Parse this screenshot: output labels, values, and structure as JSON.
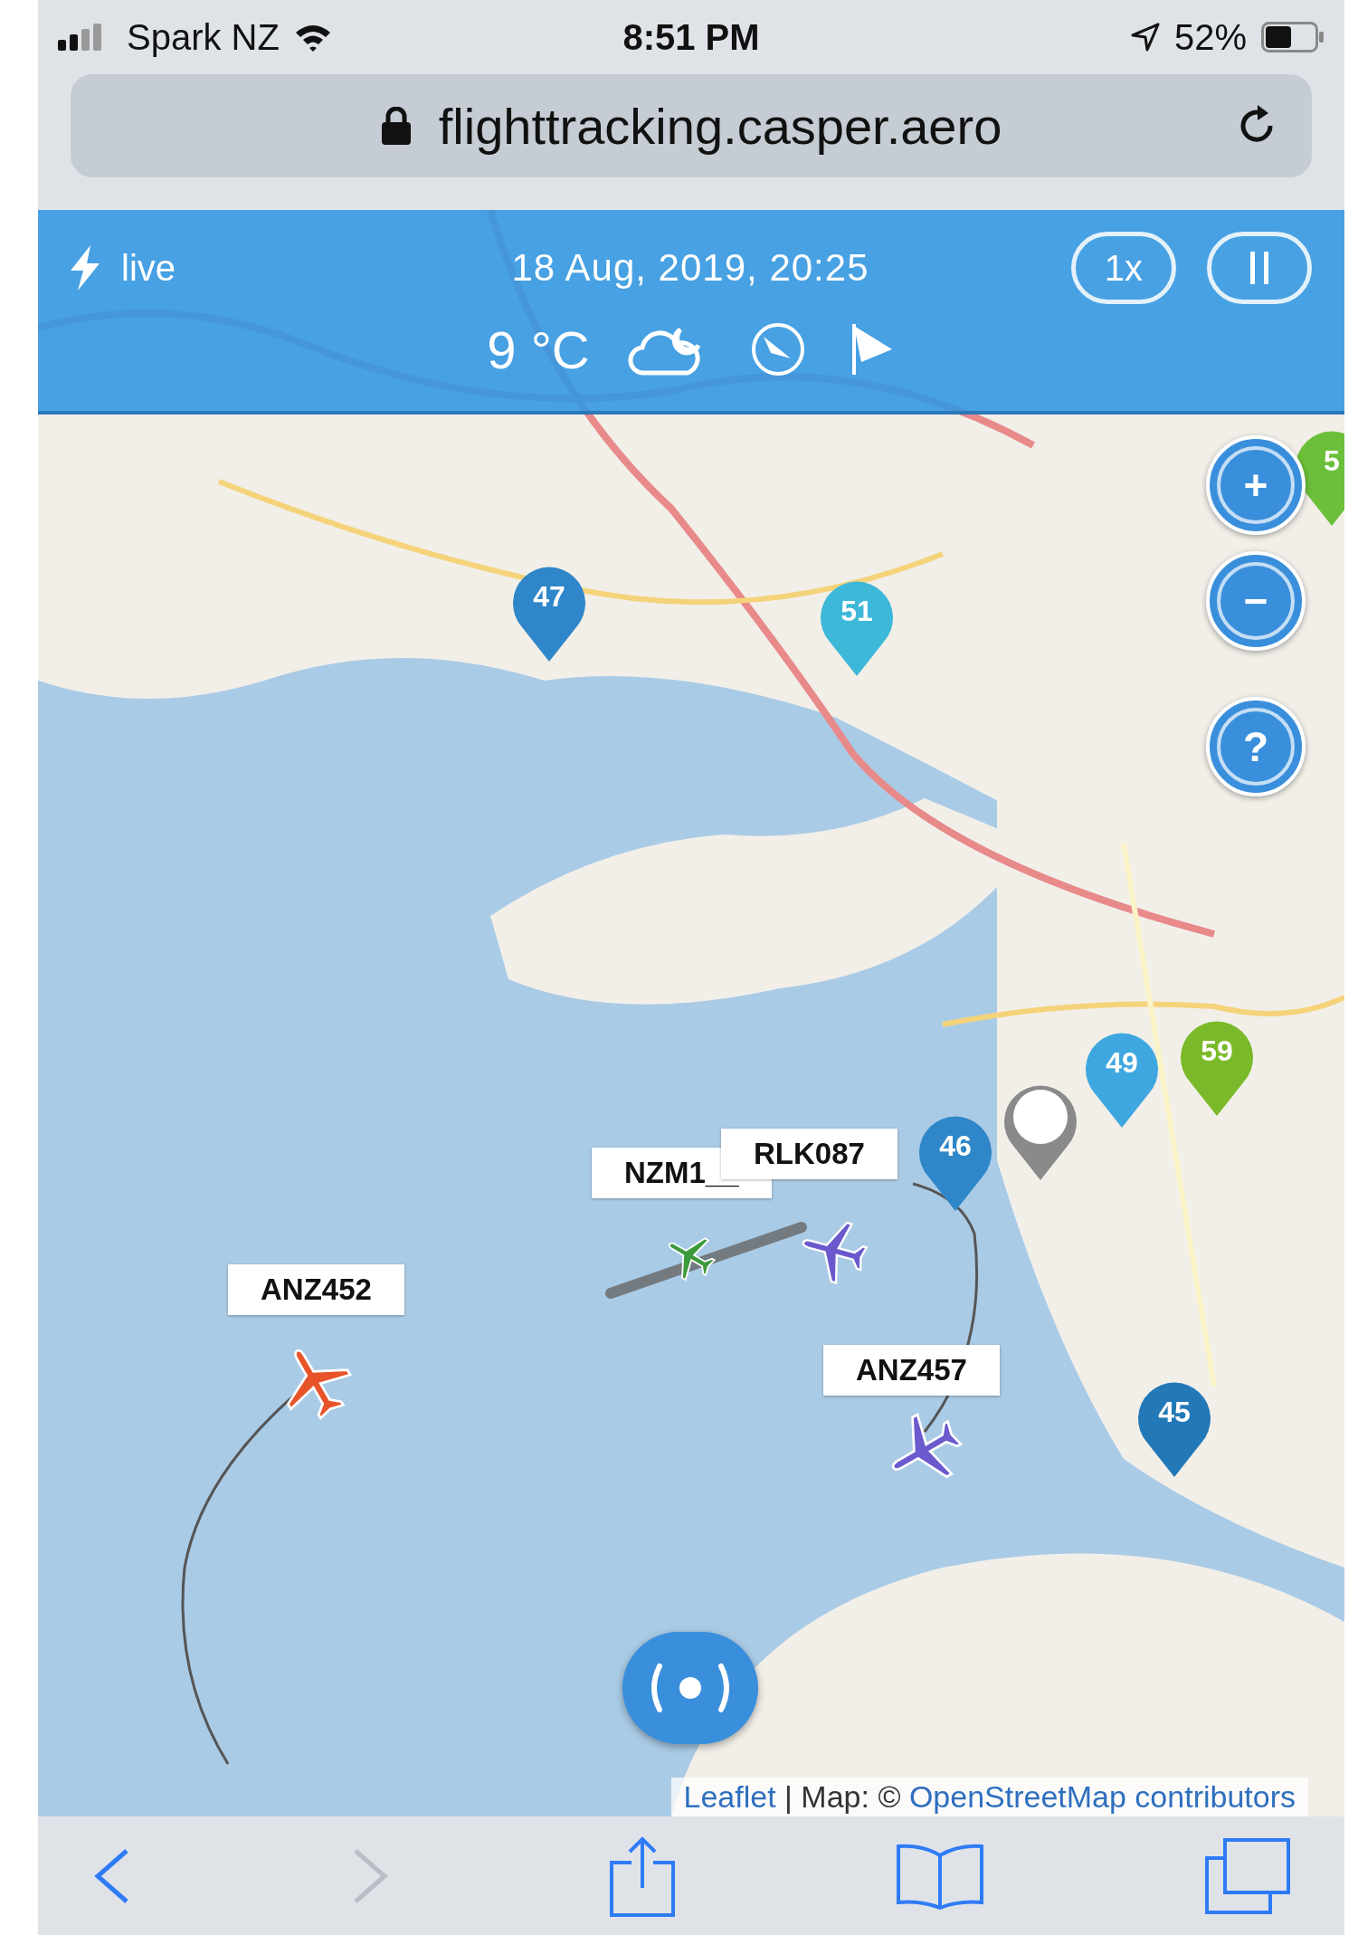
{
  "status_bar": {
    "carrier": "Spark NZ",
    "time": "8:51 PM",
    "battery": "52%"
  },
  "address_bar": {
    "url": "flighttracking.casper.aero"
  },
  "header": {
    "mode": "live",
    "datetime": "18 Aug, 2019, 20:25",
    "speed": "1x",
    "temperature": "9 °C"
  },
  "map": {
    "zoom_controls": [
      "+",
      "−",
      "?"
    ],
    "markers": [
      {
        "label": "5",
        "color": "#6cbf3a"
      },
      {
        "label": "47",
        "color": "#2f87c9"
      },
      {
        "label": "51",
        "color": "#3db8d8"
      },
      {
        "label": "59",
        "color": "#7ab929"
      },
      {
        "label": "49",
        "color": "#3fa7e0"
      },
      {
        "color": "#8a8a8a"
      },
      {
        "label": "46",
        "color": "#2f87c9"
      },
      {
        "label": "45",
        "color": "#2379b8"
      }
    ],
    "flights": [
      {
        "callsign": "NZM1__",
        "color": "#3d9a3d"
      },
      {
        "callsign": "RLK087",
        "color": "#6a5acd"
      },
      {
        "callsign": "ANZ452",
        "color": "#e8542a"
      },
      {
        "callsign": "ANZ457",
        "color": "#6a5acd"
      }
    ],
    "attribution": {
      "link": "Leaflet",
      "text": "| Map: ©",
      "source": "OpenStreetMap contributors"
    }
  },
  "toolbar": {
    "forward_disabled": true
  }
}
